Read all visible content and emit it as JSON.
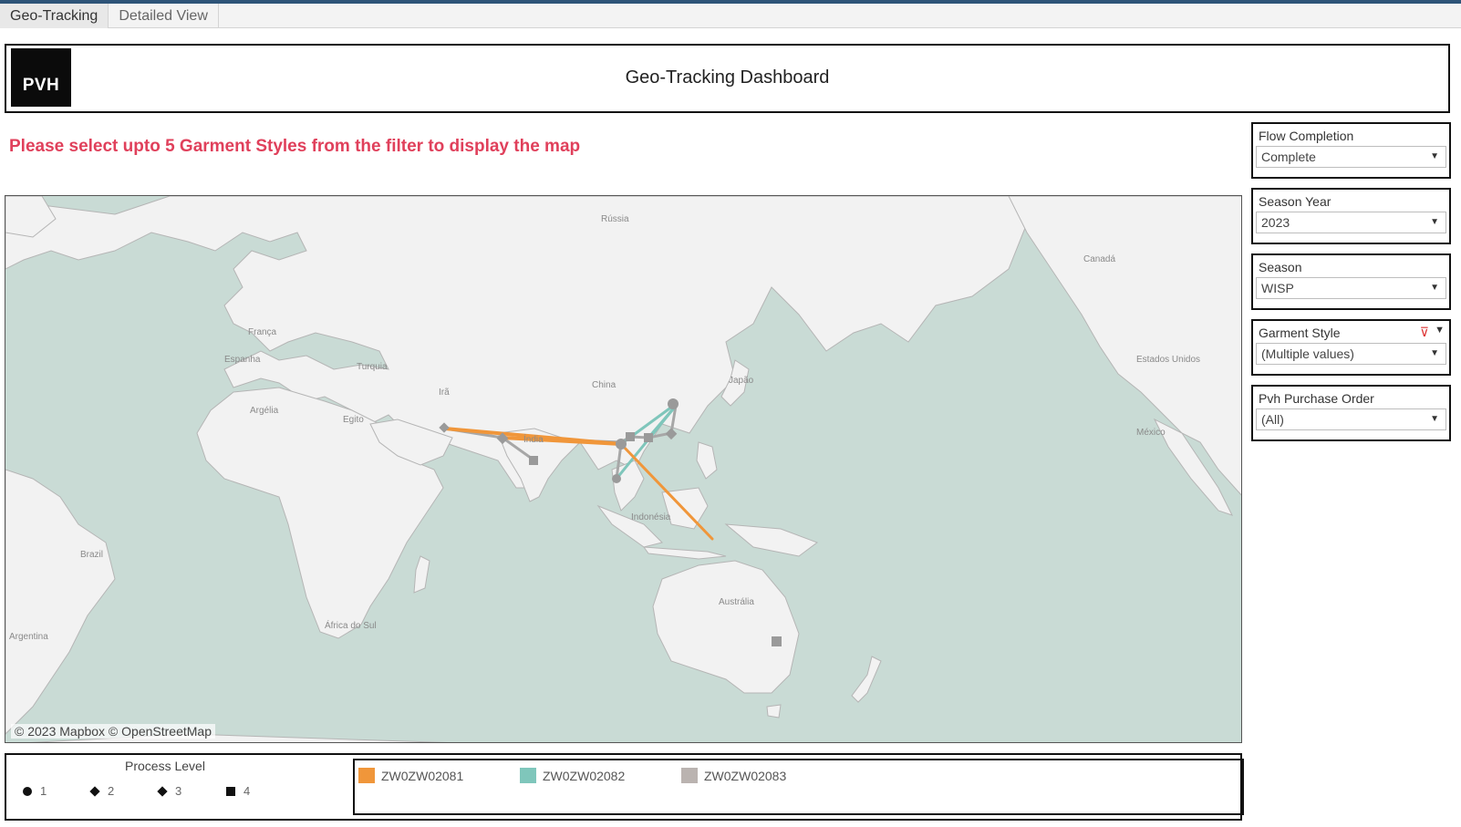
{
  "tabs": [
    {
      "label": "Geo-Tracking",
      "active": true
    },
    {
      "label": "Detailed View",
      "active": false
    }
  ],
  "header": {
    "logo_text": "PVH",
    "title": "Geo-Tracking Dashboard"
  },
  "notice": "Please select upto 5 Garment Styles from the filter to display the map",
  "map": {
    "attribution": "© 2023 Mapbox © OpenStreetMap",
    "labels": [
      "Rússia",
      "Canadá",
      "França",
      "Espanha",
      "Turquia",
      "Irã",
      "China",
      "Japão",
      "Estados Unidos",
      "México",
      "Argélia",
      "Egito",
      "Índia",
      "Indonésia",
      "Austrália",
      "Brazil",
      "Argentina",
      "África do Sul"
    ],
    "colors": {
      "ocean": "#c9dbd5",
      "land": "#f2f2f2",
      "border": "#b5b5b5"
    }
  },
  "filters": [
    {
      "label": "Flow Completion",
      "value": "Complete"
    },
    {
      "label": "Season Year",
      "value": "2023"
    },
    {
      "label": "Season",
      "value": "WISP"
    },
    {
      "label": "Garment Style",
      "value": "(Multiple values)"
    },
    {
      "label": "Pvh Purchase Order",
      "value": "(All)"
    }
  ],
  "legend": {
    "shape_title": "Process Level",
    "shapes": [
      {
        "label": "1",
        "icon": "circle-icon"
      },
      {
        "label": "2",
        "icon": "diamond-icon"
      },
      {
        "label": "3",
        "icon": "diamond-icon"
      },
      {
        "label": "4",
        "icon": "square-icon"
      }
    ],
    "styles": [
      {
        "label": "ZW0ZW02081",
        "color": "#f0963a"
      },
      {
        "label": "ZW0ZW02082",
        "color": "#7fc6bb"
      },
      {
        "label": "ZW0ZW02083",
        "color": "#bab3b0"
      }
    ]
  }
}
